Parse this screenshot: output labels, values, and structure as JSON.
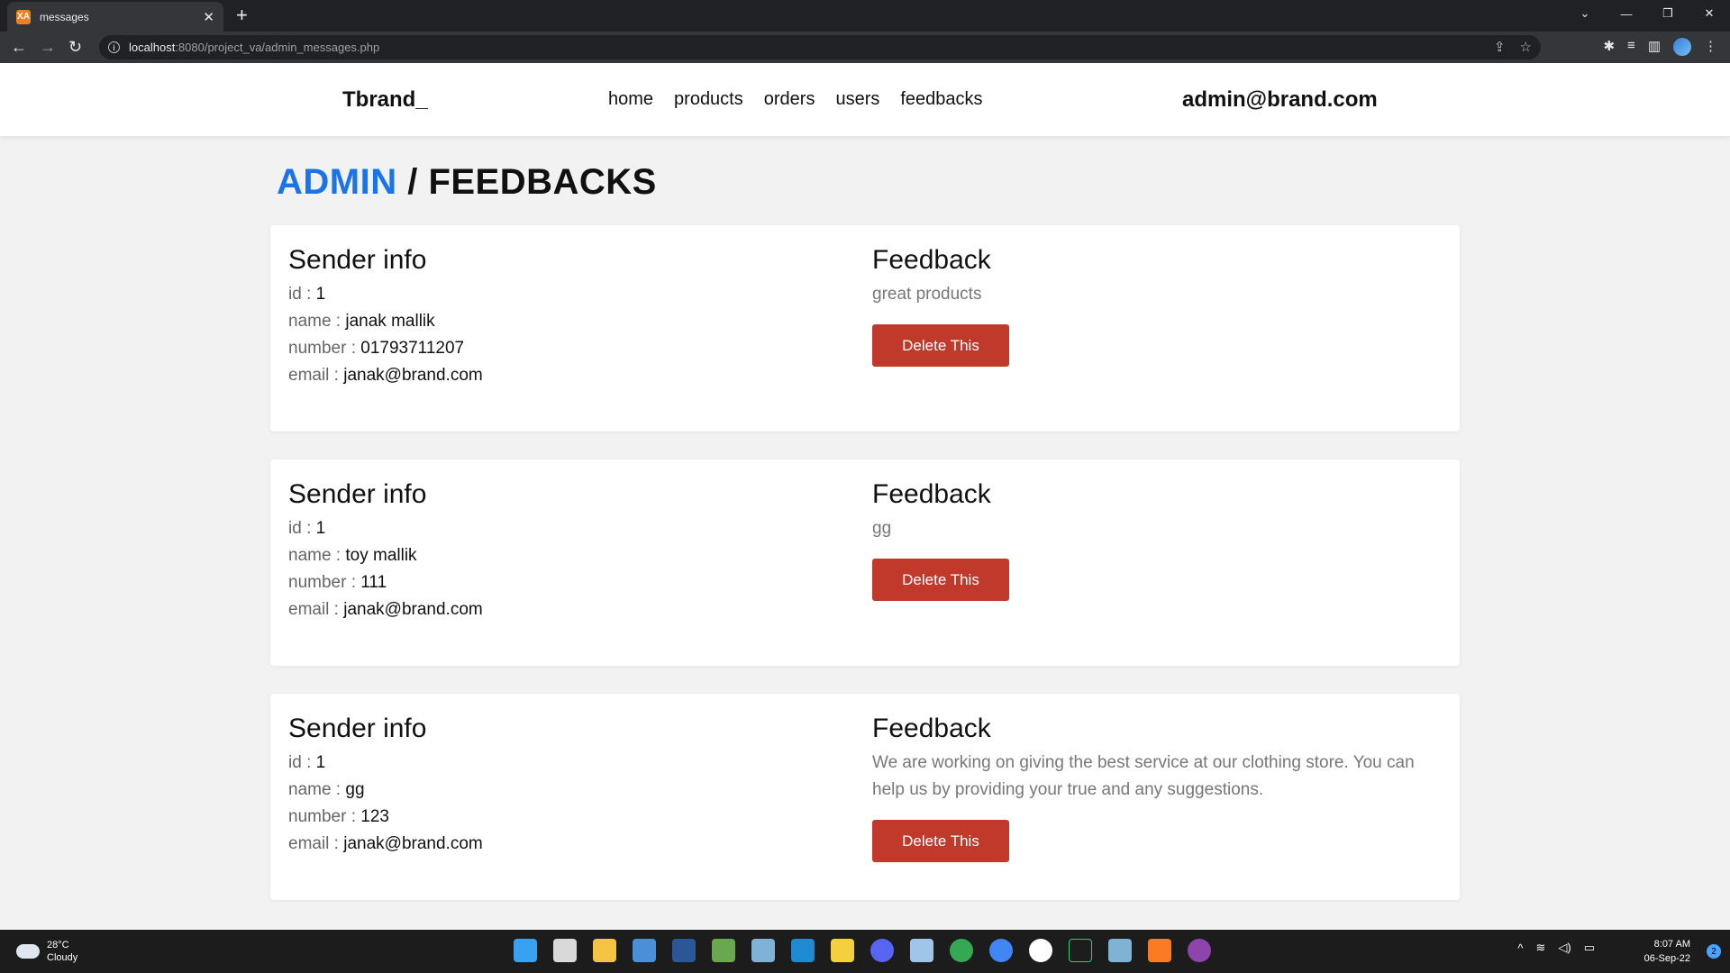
{
  "browser": {
    "tab_title": "messages",
    "favicon_label": "XA",
    "url_host": "localhost",
    "url_path": ":8080/project_va/admin_messages.php"
  },
  "header": {
    "brand": "Tbrand_",
    "nav": [
      "home",
      "products",
      "orders",
      "users",
      "feedbacks"
    ],
    "admin_email": "admin@brand.com"
  },
  "page": {
    "crumb": "ADMIN",
    "separator": " / ",
    "title": "FEEDBACKS"
  },
  "labels": {
    "sender_info": "Sender info",
    "feedback": "Feedback",
    "id": "id : ",
    "name": "name : ",
    "number": "number : ",
    "email": "email : ",
    "delete": "Delete This"
  },
  "feedbacks": [
    {
      "id": "1",
      "name": "janak mallik",
      "number": "01793711207",
      "email": "janak@brand.com",
      "message": "great products"
    },
    {
      "id": "1",
      "name": "toy mallik",
      "number": "111",
      "email": "janak@brand.com",
      "message": "gg"
    },
    {
      "id": "1",
      "name": "gg",
      "number": "123",
      "email": "janak@brand.com",
      "message": "We are working on giving the best service at our clothing store. You can help us by providing your true and any suggestions."
    }
  ],
  "taskbar": {
    "temperature": "28°C",
    "weather": "Cloudy",
    "time": "8:07 AM",
    "date": "06-Sep-22",
    "notifications": "2"
  },
  "colors": {
    "accent_blue": "#1a73e8",
    "delete_red": "#c0392b"
  }
}
